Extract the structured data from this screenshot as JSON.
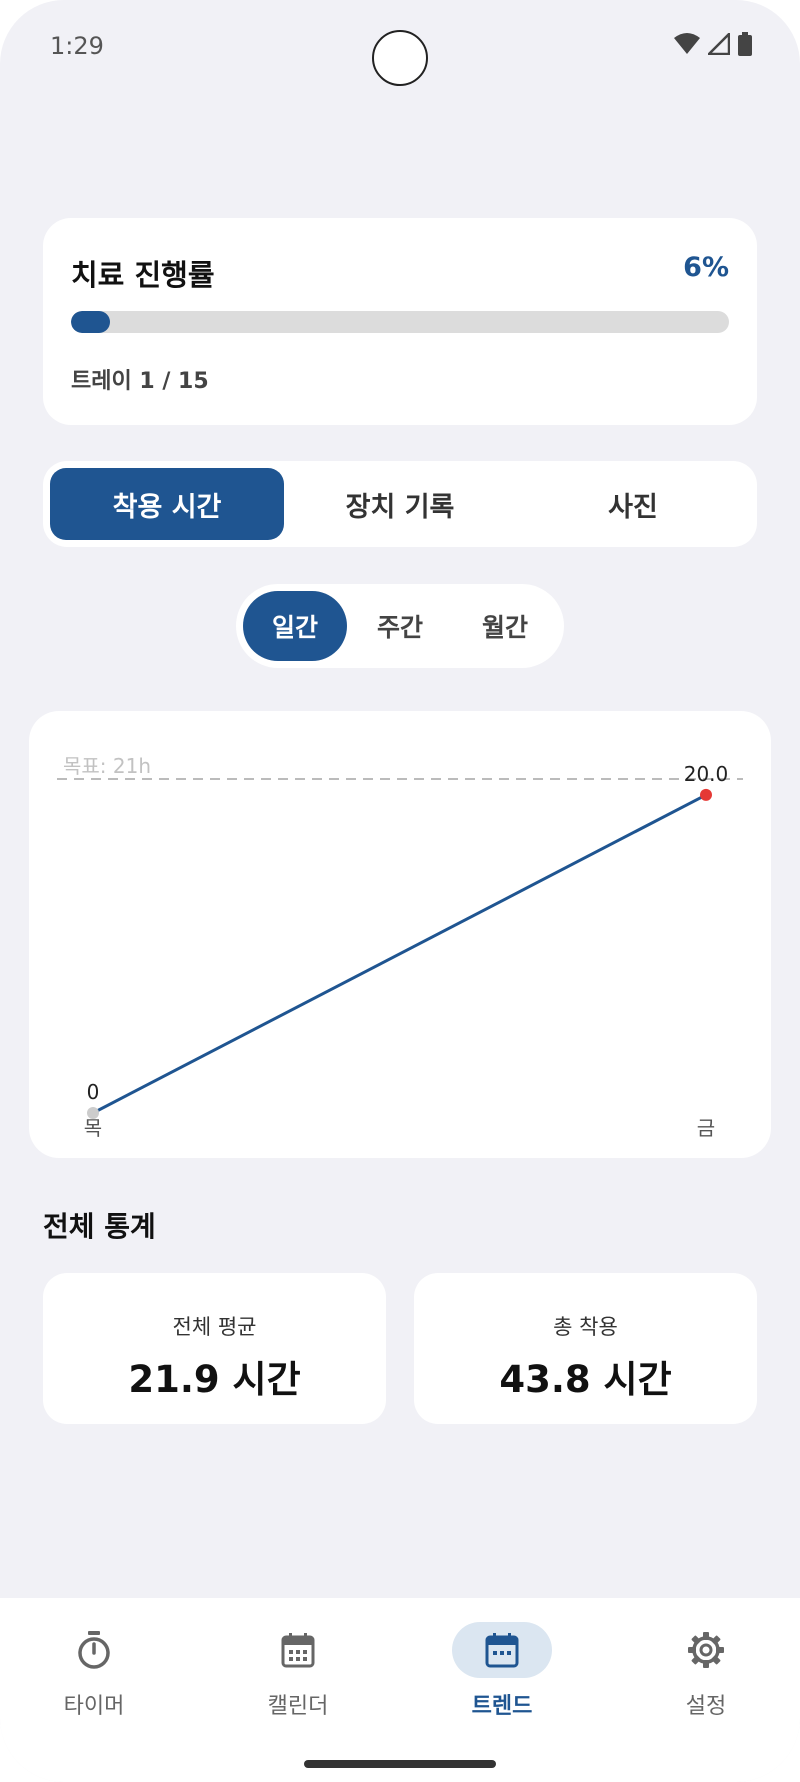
{
  "status_bar": {
    "time": "1:29"
  },
  "progress": {
    "title": "치료 진행률",
    "percent_label": "6%",
    "percent": 6,
    "subtitle": "트레이 1 / 15"
  },
  "main_tabs": [
    {
      "label": "착용 시간",
      "active": true
    },
    {
      "label": "장치 기록",
      "active": false
    },
    {
      "label": "사진",
      "active": false
    }
  ],
  "period_tabs": [
    {
      "label": "일간",
      "active": true
    },
    {
      "label": "주간",
      "active": false
    },
    {
      "label": "월간",
      "active": false
    }
  ],
  "chart_data": {
    "type": "line",
    "categories": [
      "목",
      "금"
    ],
    "values": [
      0,
      20.0
    ],
    "value_labels": [
      "0",
      "20.0"
    ],
    "goal": 21,
    "goal_label": "목표: 21h",
    "ylim": [
      0,
      21
    ],
    "line_color": "#1f5591",
    "last_point_color": "#e53935",
    "first_point_color": "#cccccc",
    "grid": false
  },
  "stats": {
    "heading": "전체 통계",
    "average": {
      "label": "전체 평균",
      "value": "21.9 시간"
    },
    "total": {
      "label": "총 착용",
      "value": "43.8 시간"
    }
  },
  "bottom_nav": [
    {
      "label": "타이머",
      "icon": "timer-icon",
      "active": false
    },
    {
      "label": "캘린더",
      "icon": "calendar-icon",
      "active": false
    },
    {
      "label": "트렌드",
      "icon": "calendar-icon",
      "active": true
    },
    {
      "label": "설정",
      "icon": "gear-icon",
      "active": false
    }
  ],
  "colors": {
    "accent": "#1f5591",
    "background": "#f1f1f6",
    "card": "#ffffff"
  }
}
